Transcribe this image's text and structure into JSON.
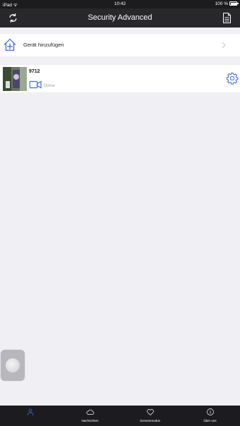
{
  "status_bar": {
    "device": "iPad",
    "time": "10:42",
    "battery": "100 %"
  },
  "nav": {
    "title": "Security Advanced",
    "left_icon": "refresh-icon",
    "right_icon": "document-icon"
  },
  "add_device": {
    "label": "Gerät hinzufügen",
    "icon": "add-home-icon"
  },
  "devices": [
    {
      "name": "9712",
      "status": "Online",
      "camera_icon": "video-camera-icon",
      "settings_icon": "gear-icon"
    }
  ],
  "tabs": [
    {
      "label": "",
      "icon": "person-icon",
      "active": true
    },
    {
      "label": "Nachrichten",
      "icon": "cloud-icon",
      "active": false
    },
    {
      "label": "Szenenmodus",
      "icon": "heart-icon",
      "active": false
    },
    {
      "label": "Über uns",
      "icon": "info-icon",
      "active": false
    }
  ],
  "colors": {
    "accent": "#3f6de0",
    "nav_bg": "#28282a",
    "tab_bg": "#1c1c1e",
    "page_bg": "#efeff4"
  }
}
